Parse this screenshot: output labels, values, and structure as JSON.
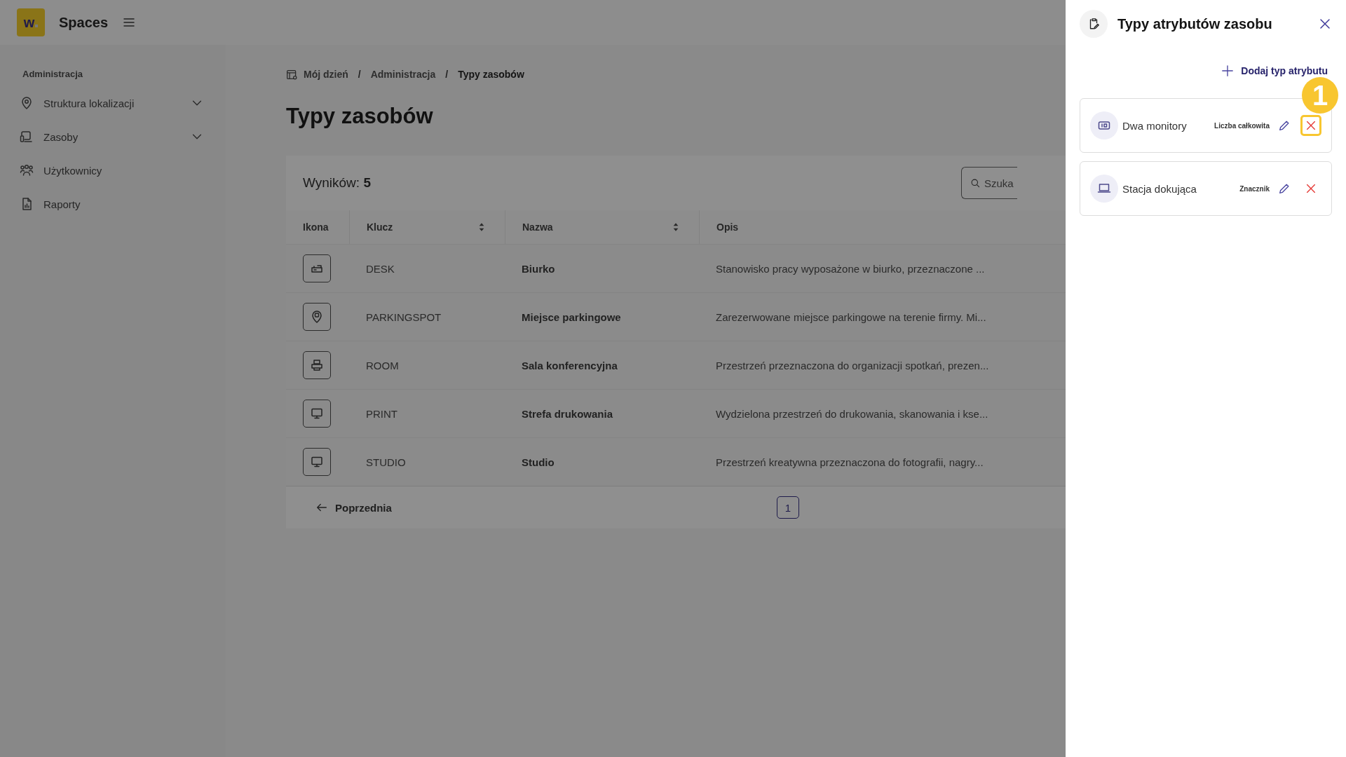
{
  "app": {
    "logo": "w",
    "name": "Spaces"
  },
  "sidebar": {
    "section": "Administracja",
    "items": [
      {
        "label": "Struktura lokalizacji",
        "has_children": true
      },
      {
        "label": "Zasoby",
        "has_children": true
      },
      {
        "label": "Użytkownicy",
        "has_children": false
      },
      {
        "label": "Raporty",
        "has_children": false
      }
    ]
  },
  "breadcrumb": {
    "separator": "/",
    "items": [
      "Mój dzień",
      "Administracja",
      "Typy zasobów"
    ]
  },
  "page_title": "Typy zasobów",
  "results": {
    "label": "Wyników:",
    "count": "5"
  },
  "search": {
    "placeholder": "Szuka"
  },
  "table": {
    "columns": [
      {
        "label": "Ikona",
        "sortable": false
      },
      {
        "label": "Klucz",
        "sortable": true
      },
      {
        "label": "Nazwa",
        "sortable": true
      },
      {
        "label": "Opis",
        "sortable": false
      }
    ],
    "rows": [
      {
        "key": "DESK",
        "name": "Biurko",
        "description": "Stanowisko pracy wyposażone w biurko, przeznaczone ..."
      },
      {
        "key": "PARKINGSPOT",
        "name": "Miejsce parkingowe",
        "description": "Zarezerwowane miejsce parkingowe na terenie firmy. Mi..."
      },
      {
        "key": "ROOM",
        "name": "Sala konferencyjna",
        "description": "Przestrzeń przeznaczona do organizacji spotkań, prezen..."
      },
      {
        "key": "PRINT",
        "name": "Strefa drukowania",
        "description": "Wydzielona przestrzeń do drukowania, skanowania i kse..."
      },
      {
        "key": "STUDIO",
        "name": "Studio",
        "description": "Przestrzeń kreatywna przeznaczona do fotografii, nagry..."
      }
    ]
  },
  "pagination": {
    "previous": "Poprzednia",
    "pages": [
      {
        "label": "1",
        "selected": true
      }
    ]
  },
  "panel": {
    "title": "Typy atrybutów zasobu",
    "add_button": "Dodaj typ atrybutu",
    "callout": "1",
    "attributes": [
      {
        "name": "Dwa monitory",
        "type": "Liczba całkowita",
        "highlighted": true
      },
      {
        "name": "Stacja dokująca",
        "type": "Znacznik",
        "highlighted": false
      }
    ]
  }
}
